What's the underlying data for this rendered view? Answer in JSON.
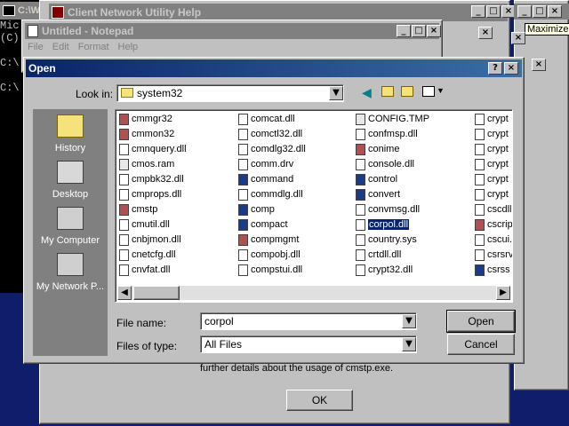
{
  "cmd": {
    "title": "C:\\WI",
    "lines": [
      "Mic",
      "(C)",
      "",
      "C:\\",
      "",
      "C:\\"
    ]
  },
  "help_window": {
    "title": "Client Network Utility Help",
    "tooltip": "Maximize",
    "body_text": "further details about the usage of cmstp.exe.",
    "ok_label": "OK"
  },
  "notepad": {
    "title": "Untitled - Notepad",
    "menu": [
      "File",
      "Edit",
      "Format",
      "Help"
    ]
  },
  "open_dialog": {
    "title": "Open",
    "look_in_label": "Look in:",
    "look_in_value": "system32",
    "places": [
      "History",
      "Desktop",
      "My Computer",
      "My Network P..."
    ],
    "file_name_label": "File name:",
    "file_name_value": "corpol",
    "files_of_type_label": "Files of type:",
    "files_of_type_value": "All Files",
    "open_label": "Open",
    "cancel_label": "Cancel",
    "help_glyph": "?",
    "close_glyph": "×",
    "columns": [
      [
        {
          "name": "cmmgr32",
          "icon": "exe-icon"
        },
        {
          "name": "cmmon32",
          "icon": "exe-icon"
        },
        {
          "name": "cmnquery.dll",
          "icon": "dll-icon"
        },
        {
          "name": "cmos.ram",
          "icon": "file-icon"
        },
        {
          "name": "cmpbk32.dll",
          "icon": "dll-icon"
        },
        {
          "name": "cmprops.dll",
          "icon": "dll-icon"
        },
        {
          "name": "cmstp",
          "icon": "exe-icon"
        },
        {
          "name": "cmutil.dll",
          "icon": "dll-icon"
        },
        {
          "name": "cnbjmon.dll",
          "icon": "dll-icon"
        },
        {
          "name": "cnetcfg.dll",
          "icon": "dll-icon"
        },
        {
          "name": "cnvfat.dll",
          "icon": "dll-icon"
        }
      ],
      [
        {
          "name": "comcat.dll",
          "icon": "dll-icon"
        },
        {
          "name": "comctl32.dll",
          "icon": "dll-icon"
        },
        {
          "name": "comdlg32.dll",
          "icon": "dll-icon"
        },
        {
          "name": "comm.drv",
          "icon": "dll-icon"
        },
        {
          "name": "command",
          "icon": "window-icon"
        },
        {
          "name": "commdlg.dll",
          "icon": "dll-icon"
        },
        {
          "name": "comp",
          "icon": "window-icon"
        },
        {
          "name": "compact",
          "icon": "window-icon"
        },
        {
          "name": "compmgmt",
          "icon": "exe-icon"
        },
        {
          "name": "compobj.dll",
          "icon": "dll-icon"
        },
        {
          "name": "compstui.dll",
          "icon": "dll-icon"
        }
      ],
      [
        {
          "name": "CONFIG.TMP",
          "icon": "file-icon"
        },
        {
          "name": "confmsp.dll",
          "icon": "dll-icon"
        },
        {
          "name": "conime",
          "icon": "exe-icon"
        },
        {
          "name": "console.dll",
          "icon": "dll-icon"
        },
        {
          "name": "control",
          "icon": "window-icon"
        },
        {
          "name": "convert",
          "icon": "window-icon"
        },
        {
          "name": "convmsg.dll",
          "icon": "dll-icon"
        },
        {
          "name": "corpol.dll",
          "icon": "dll-icon"
        },
        {
          "name": "country.sys",
          "icon": "dll-icon"
        },
        {
          "name": "crtdll.dll",
          "icon": "dll-icon"
        },
        {
          "name": "crypt32.dll",
          "icon": "dll-icon"
        }
      ],
      [
        {
          "name": "crypt",
          "icon": "dll-icon"
        },
        {
          "name": "crypt",
          "icon": "dll-icon"
        },
        {
          "name": "crypt",
          "icon": "dll-icon"
        },
        {
          "name": "crypt",
          "icon": "dll-icon"
        },
        {
          "name": "crypt",
          "icon": "dll-icon"
        },
        {
          "name": "crypt",
          "icon": "dll-icon"
        },
        {
          "name": "cscdll",
          "icon": "dll-icon"
        },
        {
          "name": "cscrip",
          "icon": "exe-icon"
        },
        {
          "name": "cscui.",
          "icon": "dll-icon"
        },
        {
          "name": "csrsrv",
          "icon": "dll-icon"
        },
        {
          "name": "csrss",
          "icon": "window-icon"
        }
      ]
    ],
    "selected": "corpol.dll",
    "colors": {
      "selection": "#0a246a",
      "title_active": "#0a246a"
    }
  }
}
